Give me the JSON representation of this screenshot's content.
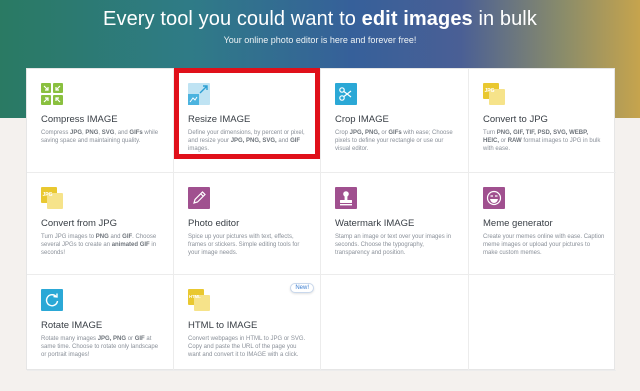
{
  "hero": {
    "title_prefix": "Every tool you could want to ",
    "title_bold": "edit images",
    "title_suffix": " in bulk",
    "subtitle": "Your online photo editor is here and forever free!"
  },
  "colors": {
    "compress": "#8ac03f",
    "resize": "#4cb3df",
    "crop": "#2ba8d6",
    "convert_to": "#e9c830",
    "convert_from": "#e9c830",
    "editor": "#a0508f",
    "watermark": "#a0508f",
    "meme": "#a0508f",
    "rotate": "#2ba8d6",
    "html": "#e9c830",
    "highlight": "#e0101a"
  },
  "tools": [
    {
      "title": "Compress IMAGE",
      "icon": "compress-icon",
      "desc_parts": [
        "Compress ",
        "JPG",
        ", ",
        "PNG",
        ", ",
        "SVG",
        ", and ",
        "GIFs",
        " while saving space and maintaining quality."
      ]
    },
    {
      "title": "Resize IMAGE",
      "icon": "resize-icon",
      "desc_parts": [
        "Define your dimensions, by percent or pixel, and resize your ",
        "JPG, PNG, SVG,",
        " and ",
        "GIF",
        " images."
      ]
    },
    {
      "title": "Crop IMAGE",
      "icon": "crop-icon",
      "desc_parts": [
        "Crop ",
        "JPG, PNG,",
        " or ",
        "GIFs",
        " with ease; Choose pixels to define your rectangle or use our visual editor."
      ]
    },
    {
      "title": "Convert to JPG",
      "icon": "convert-to-jpg-icon",
      "badge": "JPG",
      "desc_parts": [
        "Turn ",
        "PNG, GIF, TIF, PSD, SVG, WEBP, HEIC,",
        " or ",
        "RAW",
        " format images to JPG in bulk with ease."
      ]
    },
    {
      "title": "Convert from JPG",
      "icon": "convert-from-jpg-icon",
      "badge": "JPG",
      "desc_parts": [
        "Turn JPG images to ",
        "PNG",
        " and ",
        "GIF",
        ". Choose several JPGs to create an ",
        "animated GIF",
        " in seconds!"
      ]
    },
    {
      "title": "Photo editor",
      "icon": "photo-editor-icon",
      "desc_parts": [
        "Spice up your pictures with text, effects, frames or stickers. Simple editing tools for your image needs."
      ]
    },
    {
      "title": "Watermark IMAGE",
      "icon": "watermark-icon",
      "desc_parts": [
        "Stamp an image or text over your images in seconds. Choose the typography, transparency and position."
      ]
    },
    {
      "title": "Meme generator",
      "icon": "meme-icon",
      "desc_parts": [
        "Create your memes online with ease. Caption meme images or upload your pictures to make custom memes."
      ]
    },
    {
      "title": "Rotate IMAGE",
      "icon": "rotate-icon",
      "desc_parts": [
        "Rotate many images ",
        "JPG, PNG",
        " or ",
        "GIF",
        " at same time. Choose to rotate only landscape or portrait images!"
      ]
    },
    {
      "title": "HTML to IMAGE",
      "icon": "html-icon",
      "badge": "HTML",
      "new_label": "New!",
      "desc_parts": [
        "Convert webpages in HTML to JPG or SVG. Copy and paste the URL of the page you want and convert it to IMAGE with a click."
      ]
    }
  ]
}
